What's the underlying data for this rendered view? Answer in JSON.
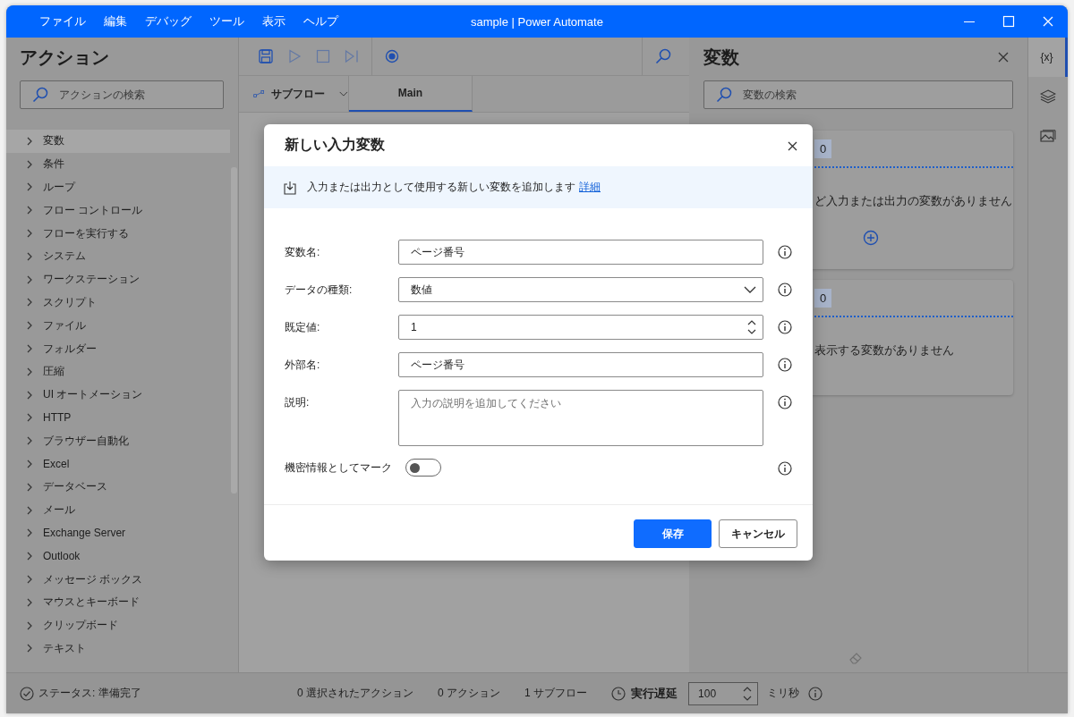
{
  "window": {
    "title": "sample | Power Automate",
    "menu": [
      "ファイル",
      "編集",
      "デバッグ",
      "ツール",
      "表示",
      "ヘルプ"
    ]
  },
  "actions_panel": {
    "title": "アクション",
    "search": {
      "placeholder": "アクションの検索"
    },
    "items": [
      {
        "label": "変数",
        "selected": true
      },
      {
        "label": "条件",
        "selected": false
      },
      {
        "label": "ループ",
        "selected": false
      },
      {
        "label": "フロー コントロール",
        "selected": false
      },
      {
        "label": "フローを実行する",
        "selected": false
      },
      {
        "label": "システム",
        "selected": false
      },
      {
        "label": "ワークステーション",
        "selected": false
      },
      {
        "label": "スクリプト",
        "selected": false
      },
      {
        "label": "ファイル",
        "selected": false
      },
      {
        "label": "フォルダー",
        "selected": false
      },
      {
        "label": "圧縮",
        "selected": false
      },
      {
        "label": "UI オートメーション",
        "selected": false
      },
      {
        "label": "HTTP",
        "selected": false
      },
      {
        "label": "ブラウザー自動化",
        "selected": false
      },
      {
        "label": "Excel",
        "selected": false
      },
      {
        "label": "データベース",
        "selected": false
      },
      {
        "label": "メール",
        "selected": false
      },
      {
        "label": "Exchange Server",
        "selected": false
      },
      {
        "label": "Outlook",
        "selected": false
      },
      {
        "label": "メッセージ ボックス",
        "selected": false
      },
      {
        "label": "マウスとキーボード",
        "selected": false
      },
      {
        "label": "クリップボード",
        "selected": false
      },
      {
        "label": "テキスト",
        "selected": false
      }
    ]
  },
  "designer": {
    "toolbar": [
      {
        "kind": "save",
        "disabled": false
      },
      {
        "kind": "run",
        "disabled": true
      },
      {
        "kind": "stop",
        "disabled": true
      },
      {
        "kind": "step",
        "disabled": true
      },
      {
        "kind": "record",
        "disabled": false
      }
    ],
    "subflows_label": "サブフロー",
    "tabs": [
      {
        "label": "Main",
        "selected": true
      }
    ]
  },
  "variables_panel": {
    "title": "変数",
    "search": {
      "placeholder": "変数の検索"
    },
    "sections": [
      {
        "count": "0",
        "empty_text": "ど入力または出力の変数がありません",
        "can_add": true
      },
      {
        "count": "0",
        "empty_text": "表示する変数がありません",
        "can_add": false
      }
    ]
  },
  "side_tabs": [
    {
      "kind": "variables",
      "label": "{x}",
      "selected": true
    },
    {
      "kind": "layers",
      "selected": false
    },
    {
      "kind": "images",
      "selected": false
    }
  ],
  "dialog": {
    "title": "新しい入力変数",
    "info": "入力または出力として使用する新しい変数を追加します",
    "info_link": "詳細",
    "fields": [
      {
        "kind": "text",
        "label": "変数名:",
        "value": "ページ番号"
      },
      {
        "kind": "dropdown",
        "label": "データの種類:",
        "value": "数値"
      },
      {
        "kind": "number",
        "label": "既定値:",
        "value": "1"
      },
      {
        "kind": "text",
        "label": "外部名:",
        "value": "ページ番号"
      },
      {
        "kind": "textarea",
        "label": "説明:",
        "placeholder": "入力の説明を追加してください"
      },
      {
        "kind": "toggle",
        "label": "機密情報としてマーク",
        "on": false
      }
    ],
    "buttons": [
      {
        "label": "保存",
        "primary": true
      },
      {
        "label": "キャンセル",
        "primary": false
      }
    ]
  },
  "status_bar": {
    "status": "ステータス: 準備完了",
    "selected_actions": "0 選択されたアクション",
    "actions": "0 アクション",
    "subflows": "1 サブフロー",
    "delay_label": "実行遅延",
    "delay_value": "100",
    "delay_unit": "ミリ秒"
  }
}
